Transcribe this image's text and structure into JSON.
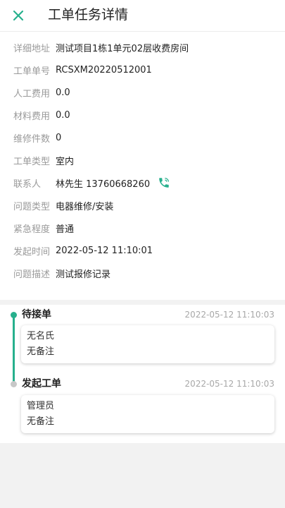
{
  "header": {
    "title": "工单任务详情"
  },
  "colors": {
    "accent": "#27b08d",
    "label": "#9a9a9a",
    "background": "#f2f2f2"
  },
  "details": {
    "address_label": "详细地址",
    "address_value": "测试项目1栋1单元02层收费房间",
    "order_no_label": "工单单号",
    "order_no_value": "RCSXM20220512001",
    "labor_cost_label": "人工费用",
    "labor_cost_value": "0.0",
    "material_cost_label": "材料费用",
    "material_cost_value": "0.0",
    "repair_count_label": "维修件数",
    "repair_count_value": "0",
    "order_type_label": "工单类型",
    "order_type_value": "室内",
    "contact_label": "联系人",
    "contact_value": "林先生 13760668260",
    "issue_type_label": "问题类型",
    "issue_type_value": "电器维修/安装",
    "urgency_label": "紧急程度",
    "urgency_value": "普通",
    "start_time_label": "发起时间",
    "start_time_value": "2022-05-12 11:10:01",
    "description_label": "问题描述",
    "description_value": "测试报修记录"
  },
  "timeline": {
    "items": [
      {
        "title": "待接单",
        "time": "2022-05-12 11:10:03",
        "person": "无名氏",
        "note": "无备注"
      },
      {
        "title": "发起工单",
        "time": "2022-05-12 11:10:03",
        "person": "管理员",
        "note": "无备注"
      }
    ]
  }
}
